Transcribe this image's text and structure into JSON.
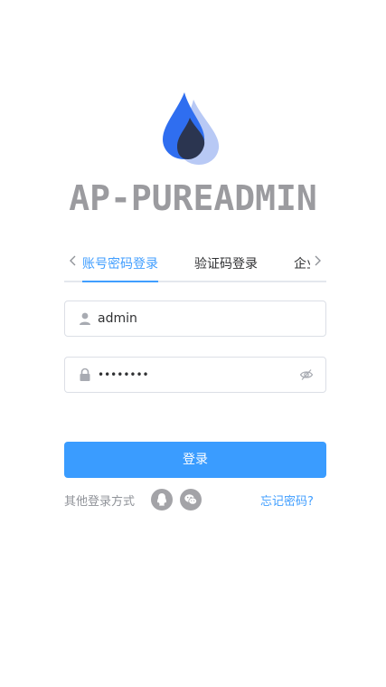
{
  "app": {
    "title": "AP-PUREADMIN"
  },
  "tabs": {
    "items": [
      {
        "label": "账号密码登录",
        "active": true
      },
      {
        "label": "验证码登录",
        "active": false
      },
      {
        "label": "企业微信登录",
        "active": false
      }
    ]
  },
  "form": {
    "username": {
      "value": "admin",
      "icon": "user-icon"
    },
    "password": {
      "value": "••••••••",
      "icon": "lock-icon",
      "toggle_icon": "eye-off-icon"
    }
  },
  "actions": {
    "login_label": "登录"
  },
  "other_login": {
    "label": "其他登录方式",
    "providers": [
      "qq-icon",
      "wechat-icon"
    ],
    "forgot_label": "忘记密码?"
  },
  "colors": {
    "accent": "#409eff",
    "button": "#3a9cff",
    "title": "#9b9b9f"
  }
}
